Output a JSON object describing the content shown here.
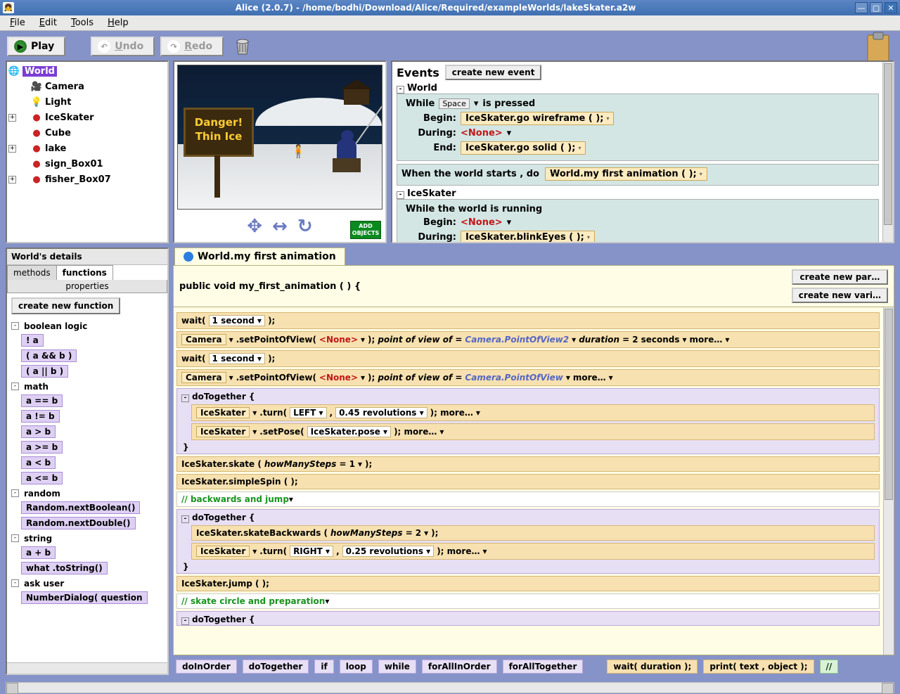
{
  "window": {
    "title": "Alice (2.0.7) - /home/bodhi/Download/Alice/Required/exampleWorlds/lakeSkater.a2w"
  },
  "menu": {
    "file": "File",
    "edit": "Edit",
    "tools": "Tools",
    "help": "Help"
  },
  "toolbar": {
    "play": "Play",
    "undo": "Undo",
    "redo": "Redo"
  },
  "tree": {
    "root": "World",
    "items": [
      {
        "name": "Camera",
        "icon": "camera"
      },
      {
        "name": "Light",
        "icon": "light"
      },
      {
        "name": "IceSkater",
        "icon": "object",
        "expandable": true
      },
      {
        "name": "Cube",
        "icon": "object"
      },
      {
        "name": "lake",
        "icon": "object",
        "expandable": true
      },
      {
        "name": "sign_Box01",
        "icon": "object"
      },
      {
        "name": "fisher_Box07",
        "icon": "object",
        "expandable": true
      }
    ]
  },
  "scene": {
    "sign_line1": "Danger!",
    "sign_line2": "Thin Ice",
    "add_objects_l1": "ADD",
    "add_objects_l2": "OBJECTS"
  },
  "events": {
    "title": "Events",
    "create": "create new event",
    "world_label": "World",
    "while": "While",
    "space": "Space",
    "is_pressed": "is pressed",
    "begin": "Begin:",
    "during": "During:",
    "end": "End:",
    "go_wireframe": "IceSkater.go wireframe (   );",
    "none": "<None>",
    "go_solid": "IceSkater.go solid (   );",
    "when_starts": "When the world starts ,  do",
    "world_anim": "World.my first animation (   );",
    "iceskater_label": "IceSkater",
    "while_running": "While the world is running",
    "blink": "IceSkater.blinkEyes (   );"
  },
  "details": {
    "title": "World's details",
    "tab_methods": "methods",
    "tab_functions": "functions",
    "tab_properties": "properties",
    "create_fn": "create new function",
    "cat_bool": "boolean logic",
    "fn_not": "! a",
    "fn_and": "( a && b )",
    "fn_or": "( a || b )",
    "cat_math": "math",
    "fn_eq": "a == b",
    "fn_ne": "a != b",
    "fn_gt": "a > b",
    "fn_ge": "a >= b",
    "fn_lt": "a < b",
    "fn_le": "a <= b",
    "cat_random": "random",
    "fn_rbool": "Random.nextBoolean()",
    "fn_rdouble": "Random.nextDouble()",
    "cat_string": "string",
    "fn_concat": "a + b",
    "fn_tostr": "what .toString()",
    "cat_ask": "ask user",
    "fn_numdlg": "NumberDialog( question"
  },
  "editor": {
    "tab": "World.my first animation",
    "signature": "public void my_first_animation ( ) {",
    "new_param": "create new par…",
    "new_var": "create new vari…",
    "wait": "wait(",
    "one_sec": "1 second",
    ");": ");",
    "camera": "Camera",
    "setpov": ".setPointOfView(",
    "none": "<None>",
    "pov_of": "point of view of =",
    "pov2": "Camera.PointOfView2",
    "dur": "duration = ",
    "twosec": "2 seconds",
    "more": "more…",
    "pov1": "Camera.PointOfView",
    "dotog": "doTogether {",
    "close": "}",
    "iceskater": "IceSkater",
    "turn": ".turn(",
    "left": "LEFT",
    "comma": ",",
    "rev45": "0.45 revolutions",
    ");m": ");  more…",
    "setpose": ".setPose(",
    "pose": "IceSkater.pose",
    "skate": "IceSkater.skate (",
    "hms": "howManySteps = ",
    "one": "1",
    "simplespin": "IceSkater.simpleSpin (   );",
    "c1": "backwards and jump",
    "skateback": "IceSkater.skateBackwards (",
    "two": "2",
    "right": "RIGHT",
    "rev25": "0.25 revolutions",
    "jump": "IceSkater.jump (   );",
    "c2": "skate circle and preparation"
  },
  "palette": {
    "doinorder": "doInOrder",
    "dotogether": "doTogether",
    "if": "if",
    "loop": "loop",
    "while": "while",
    "forallinorder": "forAllInOrder",
    "foralltogether": "forAllTogether",
    "wait": "wait( duration );",
    "print": "print( text , object );",
    "comment": "//"
  }
}
